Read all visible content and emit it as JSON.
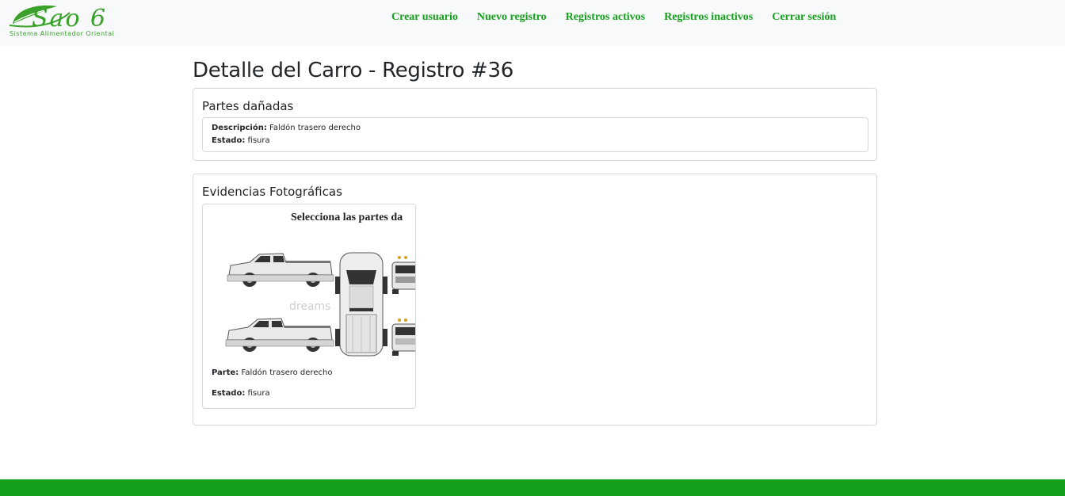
{
  "navbar": {
    "logo_text": "Sao 6",
    "logo_subtitle": "Sistema Alimentador Oriental",
    "links": [
      "Crear usuario",
      "Nuevo registro",
      "Registros activos",
      "Registros inactivos",
      "Cerrar sesión"
    ]
  },
  "page_title": "Detalle del Carro - Registro #36",
  "damaged_parts": {
    "title": "Partes dañadas",
    "items": [
      {
        "desc_label": "Descripción:",
        "desc_value": "Faldón trasero derecho",
        "state_label": "Estado:",
        "state_value": "fisura"
      }
    ]
  },
  "evidence": {
    "title": "Evidencias Fotográficas",
    "photos": [
      {
        "image_heading": "Selecciona las partes da",
        "watermark": "dreams",
        "part_label": "Parte:",
        "part_value": "Faldón trasero derecho",
        "state_label": "Estado:",
        "state_value": "fisura"
      }
    ]
  },
  "colors": {
    "brand_green": "#14a01b",
    "logo_green": "#3aa22a",
    "navbar_bg": "#f8f9fa"
  }
}
